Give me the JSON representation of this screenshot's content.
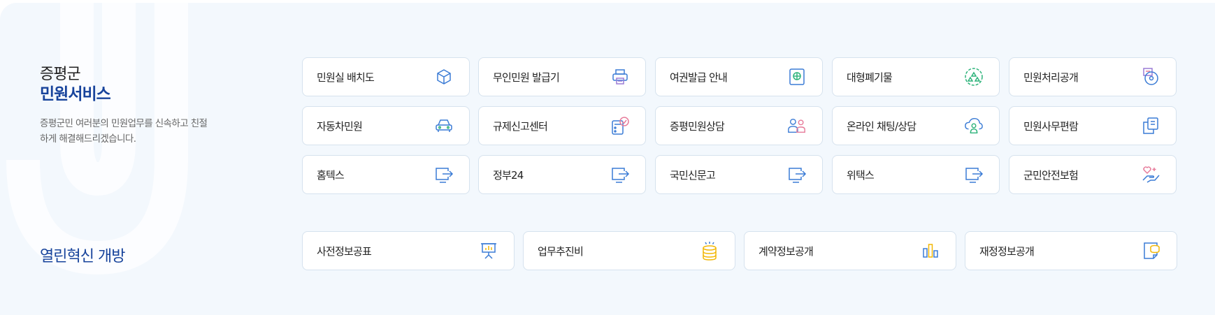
{
  "intro": {
    "county": "증평군",
    "title": "민원서비스",
    "description": "증평군민 여러분의 민원업무를 신속하고 친절하게 해결해드리겠습니다."
  },
  "services": [
    {
      "label": "민원실 배치도",
      "icon": "cube-icon"
    },
    {
      "label": "무인민원 발급기",
      "icon": "printer-icon"
    },
    {
      "label": "여권발급 안내",
      "icon": "passport-icon"
    },
    {
      "label": "대형폐기물",
      "icon": "recycle-icon"
    },
    {
      "label": "민원처리공개",
      "icon": "document-disc-icon"
    },
    {
      "label": "자동차민원",
      "icon": "car-icon"
    },
    {
      "label": "규제신고센터",
      "icon": "calculator-check-icon"
    },
    {
      "label": "증평민원상담",
      "icon": "people-icon"
    },
    {
      "label": "온라인 채팅/상담",
      "icon": "cloud-user-icon"
    },
    {
      "label": "민원사무편람",
      "icon": "copy-document-icon"
    },
    {
      "label": "홈텍스",
      "icon": "external-link-icon"
    },
    {
      "label": "정부24",
      "icon": "external-link-icon"
    },
    {
      "label": "국민신문고",
      "icon": "external-link-icon"
    },
    {
      "label": "위택스",
      "icon": "external-link-icon"
    },
    {
      "label": "군민안전보험",
      "icon": "hand-heart-icon"
    }
  ],
  "open": {
    "title": "열린혁신 개방",
    "items": [
      {
        "label": "사전정보공표",
        "icon": "presentation-chart-icon"
      },
      {
        "label": "업무추진비",
        "icon": "coins-icon"
      },
      {
        "label": "계약정보공개",
        "icon": "bar-chart-icon"
      },
      {
        "label": "재정정보공개",
        "icon": "finance-document-icon"
      }
    ]
  },
  "colors": {
    "accent": "#17439b",
    "icon_blue": "#3a7bd5",
    "icon_green": "#2db37a",
    "icon_pink": "#e77b9a",
    "icon_purple": "#9b7bd6",
    "icon_yellow": "#f2b705",
    "panel_bg": "#f3f8fd"
  }
}
